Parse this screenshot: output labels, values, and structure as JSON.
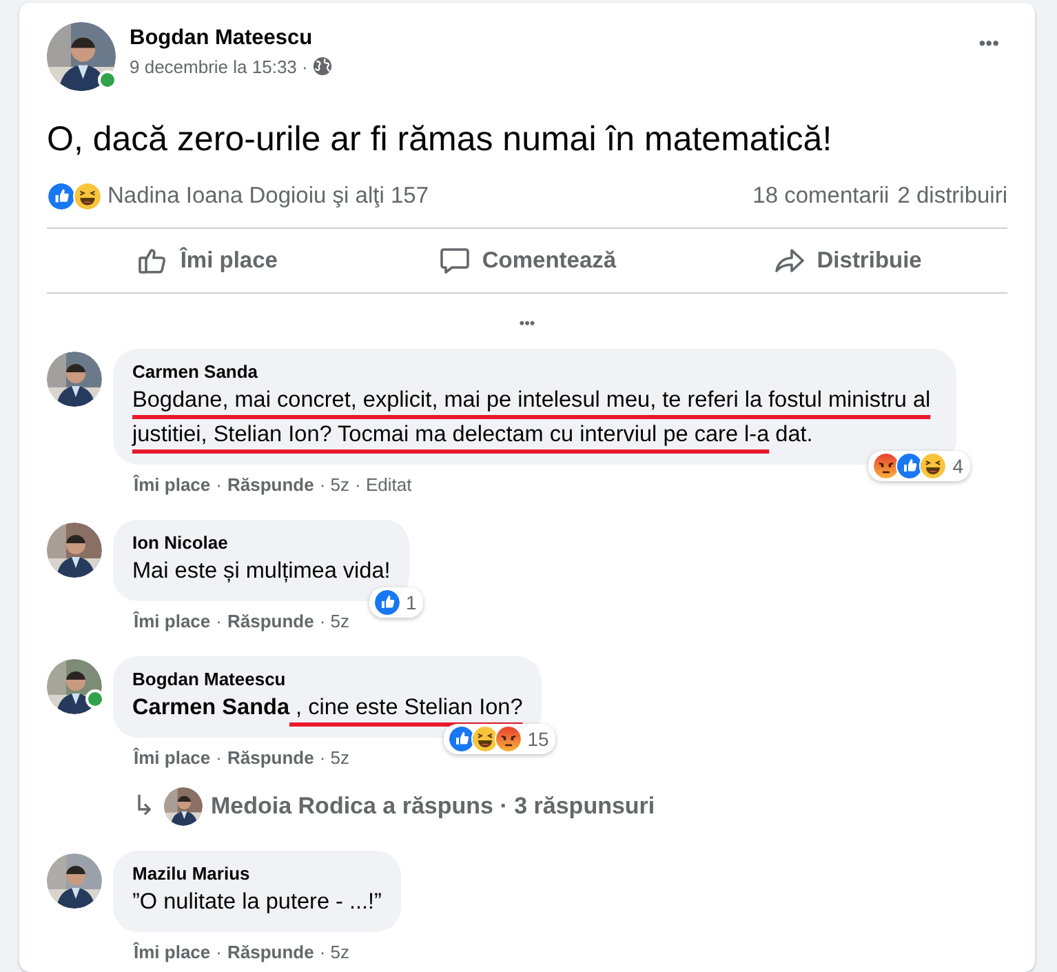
{
  "post": {
    "author": "Bogdan Mateescu",
    "online": true,
    "date": "9 decembrie la 15:33 ·",
    "more": "•••",
    "text": "O, dacă zero-urile ar fi rămas numai în matematică!",
    "reactions": [
      {
        "kind": "like"
      },
      {
        "kind": "haha"
      }
    ],
    "reacted_by": "Nadina Ioana Dogioiu şi alţi 157",
    "comments_count": "18 comentarii",
    "shares_count": "2 distribuiri",
    "actions": [
      {
        "kind": "like",
        "label": "Îmi place"
      },
      {
        "kind": "comment",
        "label": "Comentează"
      },
      {
        "kind": "share",
        "label": "Distribuie"
      }
    ],
    "more_comments": "•••"
  },
  "comments": [
    {
      "author": "Carmen Sanda",
      "online": false,
      "parts": [
        {
          "text": "Bogdane, mai concret, explicit, mai pe intelesul meu, te referi la fostul ministru al justitiei, Stelian Ion? Tocmai ma delectam cu interviul pe care l-a",
          "kind": "underlined"
        },
        {
          "text": " dat.",
          "kind": "plain"
        }
      ],
      "reactions": [
        {
          "kind": "angry"
        },
        {
          "kind": "like"
        },
        {
          "kind": "haha"
        }
      ],
      "reaction_count": "4",
      "like": "Îmi place",
      "separator": "·",
      "reply": "Răspunde",
      "time": "· 5z",
      "edited": "· Editat"
    },
    {
      "author": "Ion Nicolae",
      "online": false,
      "parts": [
        {
          "text": "Mai este și mulțimea vida!",
          "kind": "plain"
        }
      ],
      "reactions": [
        {
          "kind": "like"
        }
      ],
      "reaction_count": "1",
      "like": "Îmi place",
      "separator": "·",
      "reply": "Răspunde",
      "time": "· 5z"
    },
    {
      "author": "Bogdan Mateescu",
      "online": true,
      "parts": [
        {
          "text": "Carmen Sanda",
          "kind": "mention"
        },
        {
          "text": " , cine este Stelian Ion?",
          "kind": "underlined"
        }
      ],
      "reactions": [
        {
          "kind": "like"
        },
        {
          "kind": "haha"
        },
        {
          "kind": "angry"
        }
      ],
      "reaction_count": "15",
      "like": "Îmi place",
      "separator": "·",
      "reply": "Răspunde",
      "time": "· 5z",
      "replies": {
        "arrow": "↳",
        "text": "Medoia Rodica a răspuns · 3 răspunsuri"
      }
    },
    {
      "author": "Mazilu Marius",
      "online": false,
      "parts": [
        {
          "text": "”O nulitate la putere - ...!”",
          "kind": "plain"
        }
      ],
      "like": "Îmi place",
      "separator": "·",
      "reply": "Răspunde",
      "time": "· 5z"
    }
  ]
}
